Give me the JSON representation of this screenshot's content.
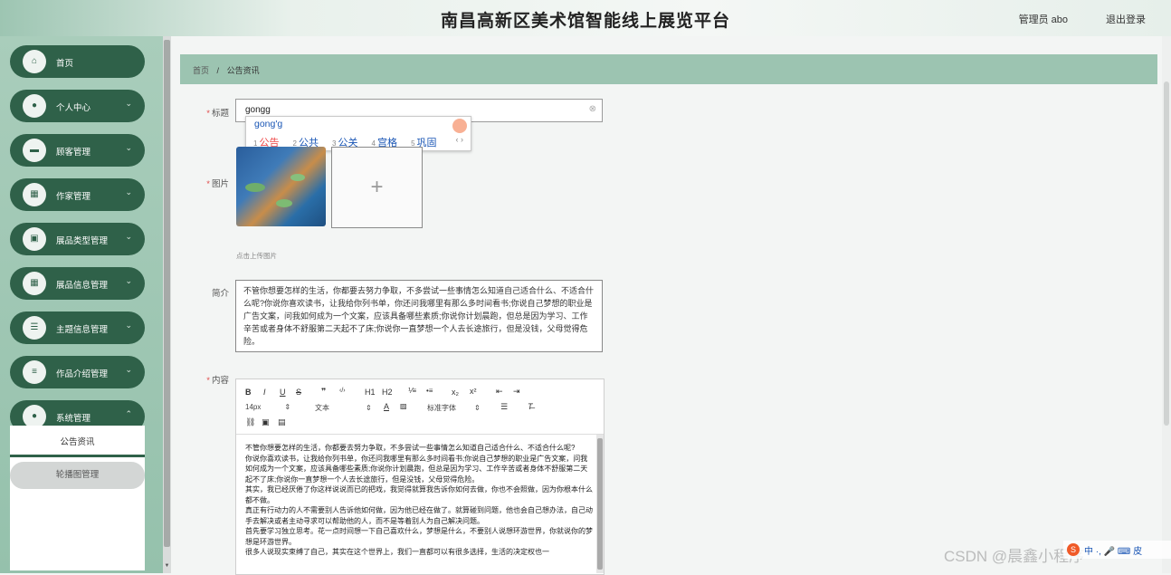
{
  "header": {
    "title": "南昌高新区美术馆智能线上展览平台",
    "user": "管理员 abo",
    "logout": "退出登录"
  },
  "sidebar": {
    "items": [
      {
        "label": "首页",
        "icon": "home-icon",
        "glyph": "⌂",
        "chevron": false
      },
      {
        "label": "个人中心",
        "icon": "user-icon",
        "glyph": "●",
        "chevron": true
      },
      {
        "label": "顾客管理",
        "icon": "monitor-icon",
        "glyph": "▬",
        "chevron": true
      },
      {
        "label": "作家管理",
        "icon": "grid-icon",
        "glyph": "▦",
        "chevron": true
      },
      {
        "label": "展品类型管理",
        "icon": "briefcase-icon",
        "glyph": "▣",
        "chevron": true
      },
      {
        "label": "展品信息管理",
        "icon": "grid-icon",
        "glyph": "▦",
        "chevron": true
      },
      {
        "label": "主题信息管理",
        "icon": "sliders-icon",
        "glyph": "☰",
        "chevron": true
      },
      {
        "label": "作品介绍管理",
        "icon": "list-icon",
        "glyph": "≡",
        "chevron": true
      },
      {
        "label": "系统管理",
        "icon": "user-icon",
        "glyph": "●",
        "chevron": true
      }
    ],
    "submenu": {
      "active": "公告资讯",
      "next": "轮播图管理"
    }
  },
  "breadcrumb": {
    "home": "首页",
    "sep": "/",
    "current": "公告资讯"
  },
  "form": {
    "title_label": "标题",
    "title_value": "gongg",
    "image_label": "图片",
    "upload_plus": "+",
    "upload_tip": "点击上传图片",
    "intro_label": "简介",
    "intro_text": "不管你想要怎样的生活，你都要去努力争取，不多尝试一些事情怎么知道自己适合什么、不适合什么呢?你说你喜欢读书，让我给你列书单，你还问我哪里有那么多时间看书;你说自己梦想的职业是广告文案，问我如何成为一个文案，应该具备哪些素质;你说你计划晨跑，但总是因为学习、工作辛苦或者身体不舒服第二天起不了床;你说你一直梦想一个人去长途旅行，但是没钱，父母觉得危险。",
    "content_label": "内容"
  },
  "ime": {
    "composition": "gong'g",
    "candidates": [
      {
        "n": "1",
        "text": "公告"
      },
      {
        "n": "2",
        "text": "公共"
      },
      {
        "n": "3",
        "text": "公关"
      },
      {
        "n": "4",
        "text": "宫格"
      },
      {
        "n": "5",
        "text": "巩固"
      }
    ],
    "pager": "‹ ›"
  },
  "editor": {
    "toolbar_row1": [
      "B",
      "I",
      "U",
      "S",
      "❞",
      "‹/›",
      "H1",
      "H2",
      "⅟≡",
      "•≡",
      "x₂",
      "x²",
      "⇤",
      "⇥"
    ],
    "font_size": "14px",
    "paragraph": "文本",
    "font_family": "标准字体",
    "body": [
      "不管你想要怎样的生活，你都要去努力争取，不多尝试一些事情怎么知道自己适合什么、不适合什么呢?",
      "你说你喜欢读书，让我给你列书单，你还问我哪里有那么多时间看书;你说自己梦想的职业是广告文案，问我如何成为一个文案，应该具备哪些素质;你说你计划晨跑，但总是因为学习、工作辛苦或者身体不舒服第二天起不了床;你说你一直梦想一个人去长途旅行，但是没钱，父母觉得危险。",
      "其实，我已经厌倦了你这样说说而已的把戏，我觉得就算我告诉你如何去做，你也不会照做，因为你根本什么都不做。",
      "真正有行动力的人不需要别人告诉他如何做，因为他已经在做了。就算碰到问题，他也会自己想办法，自己动手去解决或者主动寻求可以帮助他的人，而不是等着别人为自己解决问题。",
      "首先要学习独立思考。花一点时间想一下自己喜欢什么，梦想是什么，不要别人说想环游世界，你就说你的梦想是环游世界。",
      "很多人说现实束缚了自己，其实在这个世界上，我们一直都可以有很多选择，生活的决定权也一"
    ]
  },
  "watermark": "CSDN @晨鑫小程序",
  "tray": {
    "logo": "S",
    "text": "中 ·, 🎤 ⌨ 皮"
  }
}
